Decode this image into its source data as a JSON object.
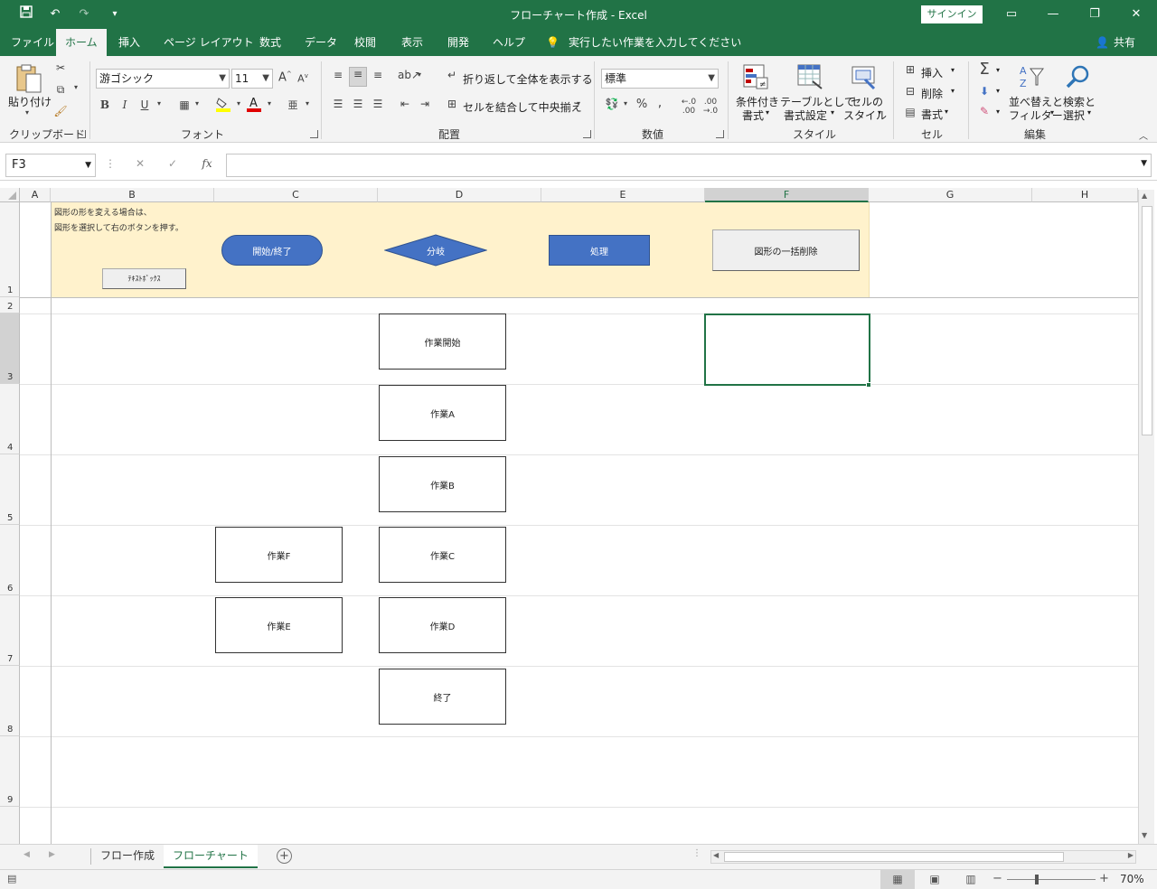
{
  "titlebar": {
    "title": "フローチャート作成  -  Excel",
    "signin": "サインイン",
    "qat": [
      "save-icon",
      "undo-icon",
      "redo-icon",
      "customize-qat-icon"
    ]
  },
  "tabs": {
    "items": [
      "ファイル",
      "ホーム",
      "挿入",
      "ページ レイアウト",
      "数式",
      "データ",
      "校閲",
      "表示",
      "開発",
      "ヘルプ"
    ],
    "tell_me": "実行したい作業を入力してください",
    "share": "共有"
  },
  "ribbon": {
    "clipboard": {
      "paste": "貼り付け",
      "label": "クリップボード"
    },
    "font": {
      "name": "游ゴシック",
      "size": "11",
      "bold": "B",
      "italic": "I",
      "underline": "U",
      "label": "フォント"
    },
    "alignment": {
      "wrap": "折り返して全体を表示する",
      "merge": "セルを結合して中央揃え",
      "label": "配置"
    },
    "number": {
      "format": "標準",
      "percent": "%",
      "comma": ",",
      "label": "数値"
    },
    "styles": {
      "conditional_1": "条件付き",
      "conditional_2": "書式",
      "table_1": "テーブルとして",
      "table_2": "書式設定",
      "cell_1": "セルの",
      "cell_2": "スタイル",
      "label": "スタイル"
    },
    "cells": {
      "insert": "挿入",
      "delete": "削除",
      "format": "書式",
      "label": "セル"
    },
    "editing": {
      "sort_1": "並べ替えと",
      "sort_2": "フィルター",
      "find_1": "検索と",
      "find_2": "選択",
      "label": "編集",
      "sum": "Σ"
    }
  },
  "formula_bar": {
    "namebox": "F3",
    "fx": "fx",
    "value": ""
  },
  "columns": [
    "A",
    "B",
    "C",
    "D",
    "E",
    "F",
    "G",
    "H"
  ],
  "rows": [
    "1",
    "2",
    "3",
    "4",
    "5",
    "6",
    "7",
    "8",
    "9"
  ],
  "sheet": {
    "note_line1": "図形の形を変える場合は、",
    "note_line2": "図形を選択して右のボタンを押す。",
    "textbox_button": "ﾃｷｽﾄﾎﾞｯｸｽ",
    "terminal_button": "開始/終了",
    "decision_button": "分岐",
    "process_button": "処理",
    "delete_all_button": "図形の一括削除",
    "shapes": [
      "作業開始",
      "作業A",
      "作業B",
      "作業C",
      "作業D",
      "終了",
      "作業F",
      "作業E"
    ]
  },
  "sheet_tabs": [
    "フロー作成",
    "フローチャート"
  ],
  "status": {
    "zoom": "70%",
    "minus": "−",
    "plus": "+"
  },
  "colors": {
    "excel_green": "#217346",
    "shape_blue": "#4472c4",
    "band_fill": "#fff2cc"
  }
}
